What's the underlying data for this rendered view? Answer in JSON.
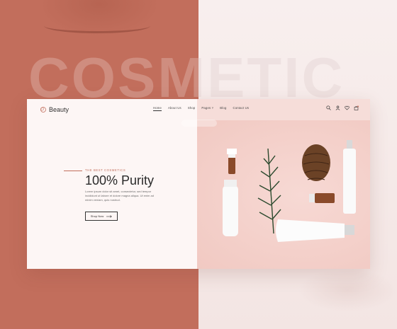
{
  "background": {
    "headline": "COSMETIC"
  },
  "nav": {
    "logo_text": "Beauty",
    "menu": [
      {
        "label": "Home",
        "active": true
      },
      {
        "label": "About Us"
      },
      {
        "label": "Shop"
      },
      {
        "label": "Pages ˅"
      },
      {
        "label": "Blog"
      },
      {
        "label": "Contact Us"
      }
    ],
    "icons": [
      "search-icon",
      "user-icon",
      "heart-icon",
      "cart-icon"
    ]
  },
  "hero": {
    "tagline": "THE BEST COSMETICS",
    "title": "100% Purity",
    "description": "Lorem ipsum dolor sit amet, consectetur, sed tempor incididunt ut labore et dolore magna aliqua. Ut enim ad minim veniam, quis nostrud.",
    "cta_label": "Shop Now",
    "cta_icon": "arrow-right-icon"
  },
  "colors": {
    "accent": "#c26e5c",
    "card_left": "#fdf6f5",
    "card_right": "#f6ddd9"
  }
}
